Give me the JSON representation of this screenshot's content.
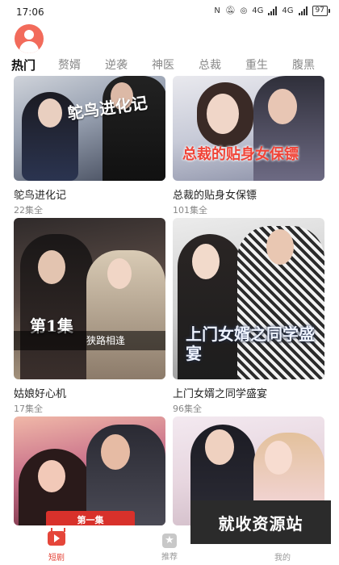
{
  "status_bar": {
    "time": "17:06",
    "signal_a": "4G",
    "signal_b": "4G",
    "battery": "97"
  },
  "tabs": [
    {
      "label": "热门",
      "active": true
    },
    {
      "label": "赘婿",
      "active": false
    },
    {
      "label": "逆袭",
      "active": false
    },
    {
      "label": "神医",
      "active": false
    },
    {
      "label": "总裁",
      "active": false
    },
    {
      "label": "重生",
      "active": false
    },
    {
      "label": "腹黑",
      "active": false
    }
  ],
  "cards": [
    {
      "title": "鸵鸟进化记",
      "episodes": "22集全",
      "poster_text": "鸵鸟进化记"
    },
    {
      "title": "总裁的贴身女保镖",
      "episodes": "101集全",
      "poster_text": "总裁的贴身女保镖"
    },
    {
      "title": "姑娘好心机",
      "episodes": "17集全",
      "poster_ep": "第1集",
      "poster_band": "狭路相逢"
    },
    {
      "title": "上门女婿之同学盛宴",
      "episodes": "96集全",
      "poster_text": "上门女婿之同学盛宴"
    },
    {
      "poster_ribbon": "第一集"
    },
    {}
  ],
  "watermark": "就收资源站",
  "bottom_nav": [
    {
      "label": "短剧",
      "icon": "tv-play-icon",
      "active": true
    },
    {
      "label": "推荐",
      "icon": "star-icon",
      "active": false
    },
    {
      "label": "我的",
      "icon": "profile-icon",
      "active": false
    }
  ],
  "colors": {
    "accent": "#e5463a",
    "avatar": "#f26b5b",
    "text_primary": "#222222",
    "text_secondary": "#888888"
  }
}
